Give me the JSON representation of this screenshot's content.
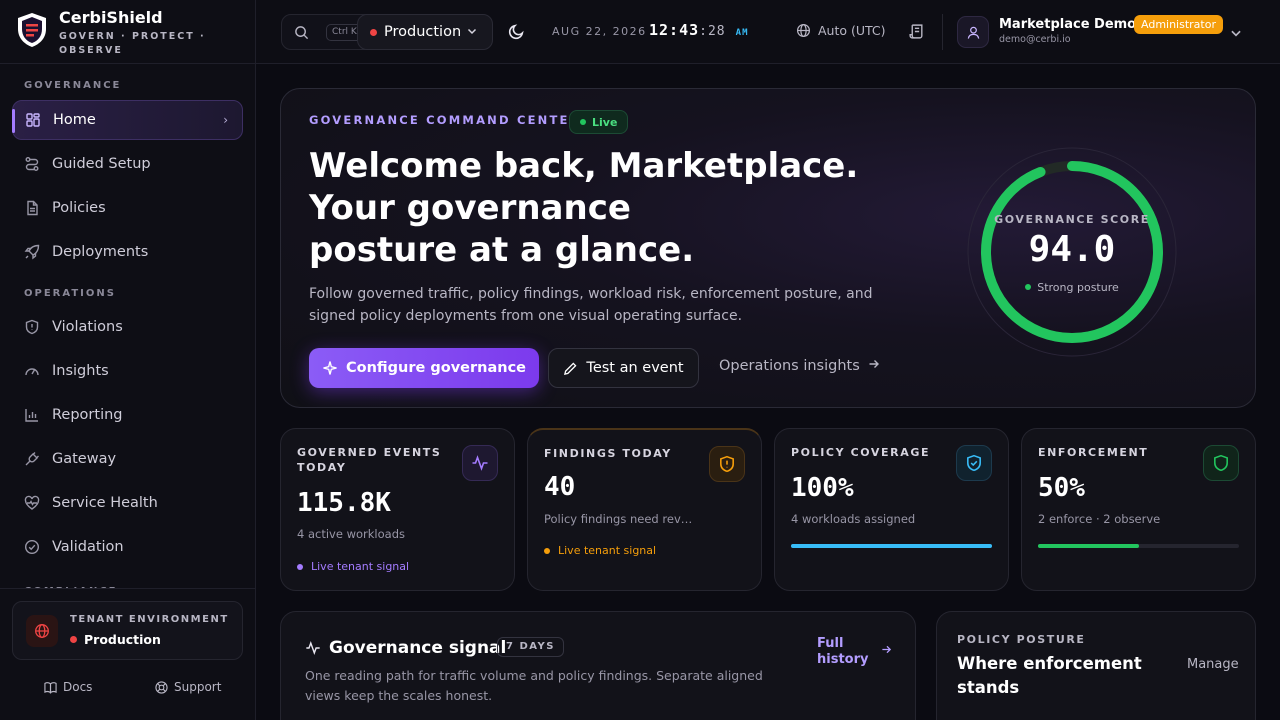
{
  "brand": {
    "name": "CerbiShield",
    "tagline": "GOVERN · PROTECT · OBSERVE"
  },
  "sidebar": {
    "sections": {
      "governance": "GOVERNANCE",
      "operations": "OPERATIONS",
      "compliance": "COMPLIANCE"
    },
    "items": [
      {
        "label": "Home",
        "icon": "grid-icon"
      },
      {
        "label": "Guided Setup",
        "icon": "route-icon"
      },
      {
        "label": "Policies",
        "icon": "document-icon"
      },
      {
        "label": "Deployments",
        "icon": "rocket-icon"
      },
      {
        "label": "Violations",
        "icon": "shield-alert-icon"
      },
      {
        "label": "Insights",
        "icon": "gauge-icon"
      },
      {
        "label": "Reporting",
        "icon": "bar-chart-icon"
      },
      {
        "label": "Gateway",
        "icon": "plug-icon"
      },
      {
        "label": "Service Health",
        "icon": "heart-pulse-icon"
      },
      {
        "label": "Validation",
        "icon": "check-circle-icon"
      }
    ],
    "tenant": {
      "label": "TENANT ENVIRONMENT",
      "value": "Production"
    },
    "footer": {
      "docs": "Docs",
      "support": "Support"
    }
  },
  "topbar": {
    "search_shortcut": "Ctrl K",
    "environment": "Production",
    "date": "AUG 22, 2026",
    "clock": {
      "hm": "12:43",
      "sec": ":28",
      "ampm": "AM"
    },
    "timezone": "Auto (UTC)",
    "user": {
      "name": "Marketplace Demo",
      "role": "Administrator",
      "email": "demo@cerbi.io"
    }
  },
  "hero": {
    "kicker": "GOVERNANCE COMMAND CENTER",
    "live": "Live",
    "headline_line1": "Welcome back, Marketplace.",
    "headline_line2": "Your governance",
    "headline_line3": "posture at a glance.",
    "description": "Follow governed traffic, policy findings, workload risk, enforcement posture, and signed policy deployments from one visual operating surface.",
    "primary_button": "Configure governance",
    "secondary_button": "Test an event",
    "link": "Operations insights",
    "score": {
      "label": "GOVERNANCE SCORE",
      "value": "94.0",
      "sub": "Strong posture",
      "percent": 94
    }
  },
  "stats": [
    {
      "label": "GOVERNED EVENTS TODAY",
      "value": "115.8K",
      "sub": "4 active workloads",
      "signal": "Live tenant signal",
      "icon": "activity-icon",
      "color": "#a47cff"
    },
    {
      "label": "FINDINGS TODAY",
      "value": "40",
      "sub": "Policy findings need review",
      "signal": "Live tenant signal",
      "icon": "shield-alert-icon",
      "color": "#f59e0b"
    },
    {
      "label": "POLICY COVERAGE",
      "value": "100%",
      "sub": "4 workloads assigned",
      "progress": 100,
      "icon": "shield-check-icon",
      "color": "#38bdf8"
    },
    {
      "label": "ENFORCEMENT",
      "value": "50%",
      "sub": "2 enforce · 2 observe",
      "progress": 50,
      "icon": "shield-icon",
      "color": "#22c55e"
    }
  ],
  "signal": {
    "title": "Governance signal",
    "badge": "7 DAYS",
    "description": "One reading path for traffic volume and policy findings. Separate aligned views keep the scales honest.",
    "link_line1": "Full",
    "link_line2": "history"
  },
  "posture": {
    "label": "POLICY POSTURE",
    "title": "Where enforcement stands",
    "action": "Manage"
  }
}
